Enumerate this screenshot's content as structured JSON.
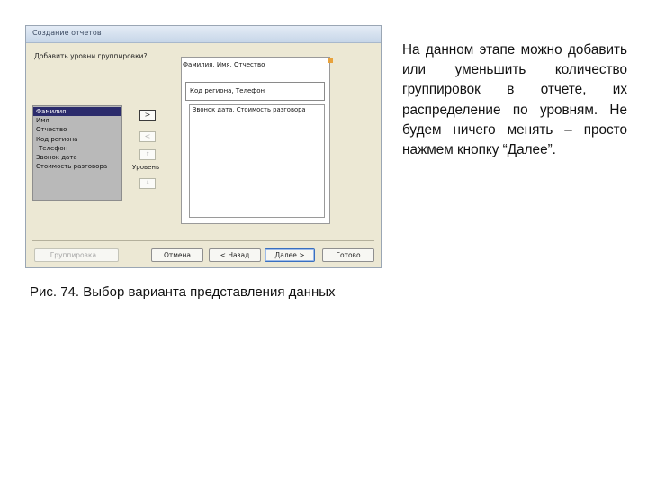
{
  "dialog": {
    "title": "Создание отчетов",
    "prompt": "Добавить уровни группировки?",
    "fields": [
      "Фамилия",
      "Имя",
      "Отчество",
      "Код региона",
      "Телефон",
      "Звонок дата",
      "Стоимость разговора"
    ],
    "selected_index": 0,
    "buttons": {
      "add": ">",
      "remove": "<",
      "priority_up": "⇑",
      "priority_down": "⇓",
      "level_label": "Уровень"
    },
    "preview": {
      "group1": "Фамилия, Имя, Отчество",
      "group2": "Код региона, Телефон",
      "detail": "Звонок дата, Стоимость разговора"
    },
    "footer": {
      "grouping": "Группировка...",
      "cancel": "Отмена",
      "back": "< Назад",
      "next": "Далее >",
      "finish": "Готово"
    }
  },
  "caption": "Рис. 74. Выбор варианта представления данных",
  "description": "На данном этапе можно добавить или уменьшить количество группировок в отчете, их распределение по уровням. Не будем ничего менять – просто нажмем кнопку “Далее”."
}
